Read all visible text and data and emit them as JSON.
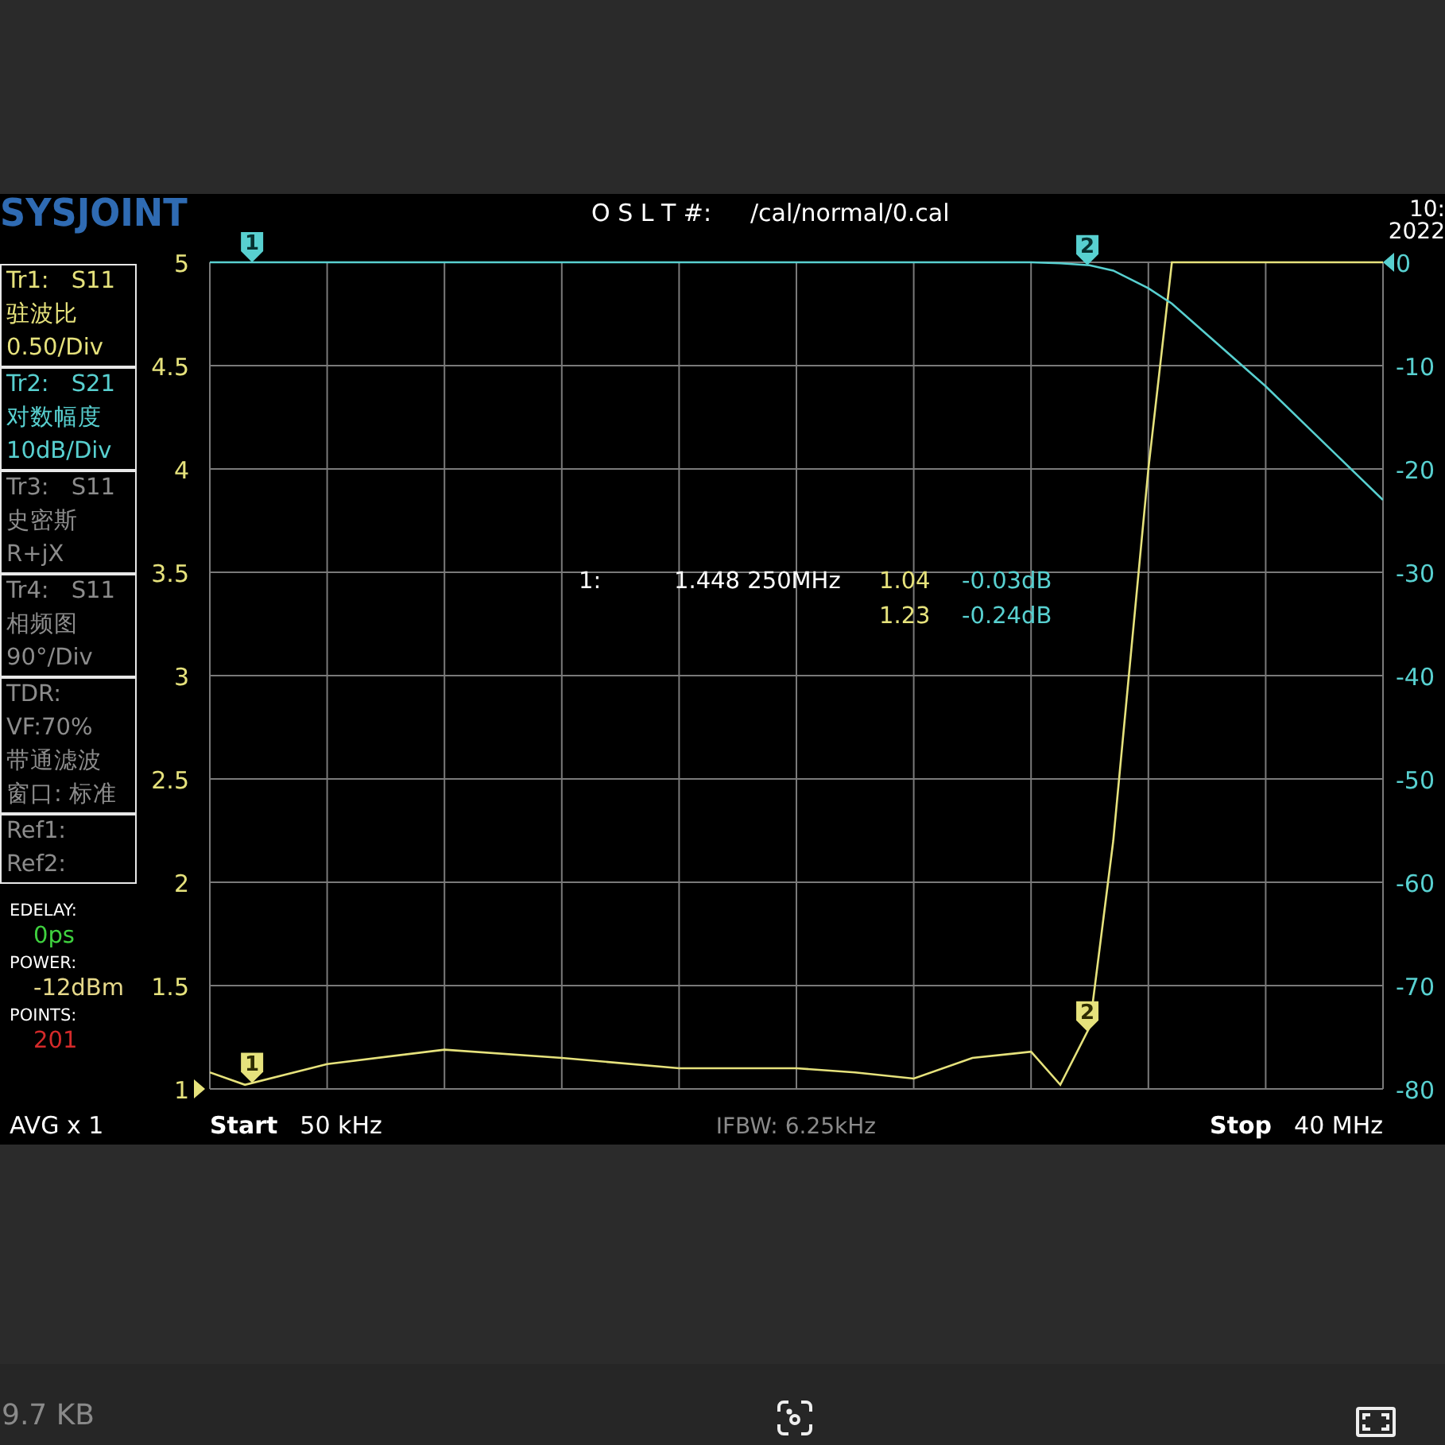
{
  "header": {
    "logo": "SYSJOINT",
    "cal_label": "O S L T #:",
    "cal_file": "/cal/normal/0.cal",
    "time": "10:",
    "date": "2022"
  },
  "panels": [
    {
      "kind": "trace",
      "name": "Tr1:",
      "param": "S11",
      "lines": [
        "驻波比",
        "0.50/Div"
      ],
      "color": "#e6e27c"
    },
    {
      "kind": "trace",
      "name": "Tr2:",
      "param": "S21",
      "lines": [
        "对数幅度",
        "10dB/Div"
      ],
      "color": "#58d0d0"
    },
    {
      "kind": "trace",
      "name": "Tr3:",
      "param": "S11",
      "lines": [
        "史密斯",
        "R+jX"
      ],
      "color": "#8c8c8c"
    },
    {
      "kind": "trace",
      "name": "Tr4:",
      "param": "S11",
      "lines": [
        "相频图",
        "90°/Div"
      ],
      "color": "#8c8c8c"
    },
    {
      "kind": "info",
      "lines": [
        "TDR:",
        "VF:70%",
        "带通滤波",
        "窗口: 标准"
      ],
      "color": "#8c8c8c"
    },
    {
      "kind": "info",
      "lines": [
        "Ref1:",
        "Ref2:"
      ],
      "color": "#8c8c8c"
    }
  ],
  "status": [
    {
      "label": "EDELAY:",
      "value": "0ps",
      "color": "#3fd13f"
    },
    {
      "label": "POWER:",
      "value": "-12dBm",
      "color": "#e6d88a"
    },
    {
      "label": "POINTS:",
      "value": "201",
      "color": "#d42a2a"
    }
  ],
  "averaging": "AVG x 1",
  "plot": {
    "left_axis": [
      "5",
      "4.5",
      "4",
      "3.5",
      "3",
      "2.5",
      "2",
      "1.5",
      "1"
    ],
    "right_axis": [
      "0",
      "-10",
      "-20",
      "-30",
      "-40",
      "-50",
      "-60",
      "-70",
      "-80"
    ],
    "transmission_markers": [
      "1",
      "2"
    ],
    "reflection_markers": [
      "1",
      "2"
    ],
    "marker_readout": [
      {
        "label": "1:",
        "frequency": "1.448 250MHz",
        "value_1": "1.04",
        "value_2": "-0.03dB"
      },
      {
        "value_1": "1.23",
        "value_2": "-0.24dB"
      }
    ]
  },
  "footer": {
    "start_label": "Start",
    "start_value": "50 kHz",
    "ifbw": "IFBW: 6.25kHz",
    "stop_label": "Stop",
    "stop_value": "40 MHz"
  },
  "viewer": {
    "file_size": "9.7 KB"
  }
}
